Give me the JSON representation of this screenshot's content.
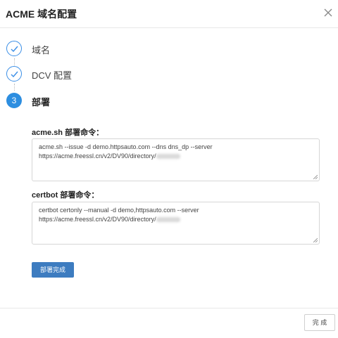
{
  "dialog": {
    "title": "ACME 域名配置",
    "close_icon": "close-icon"
  },
  "steps": [
    {
      "label": "域名",
      "status": "done",
      "icon": "check-icon"
    },
    {
      "label": "DCV 配置",
      "status": "done",
      "icon": "check-icon"
    },
    {
      "label": "部署",
      "status": "active",
      "number": "3"
    }
  ],
  "deploy": {
    "acme_label": "acme.sh 部署命令：",
    "acme_line1": "acme.sh --issue -d demo.httpsauto.com --dns dns_dp --server",
    "acme_line2": "https://acme.freessl.cn/v2/DV90/directory/",
    "certbot_label": "certbot 部署命令：",
    "certbot_line1": "certbot certonly --manual -d demo,httpsauto.com --server",
    "certbot_line2": "https://acme.freessl.cn/v2/DV90/directory/",
    "complete_deploy_button": "部署完成"
  },
  "footer": {
    "done_button": "完 成"
  },
  "colors": {
    "accent": "#2d8ee0",
    "primary_button": "#3d7cc0"
  }
}
